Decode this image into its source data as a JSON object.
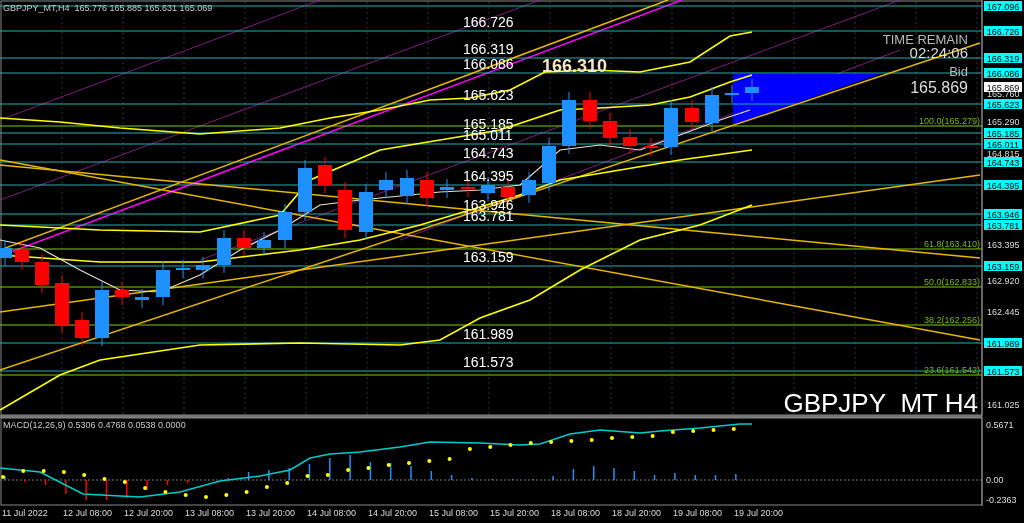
{
  "header": "GBPJPY_MT,H4  165.776 165.885 165.631 165.069",
  "levels": [
    {
      "tag": "167.096"
    },
    {
      "label": "166.726",
      "tag": "166.726"
    },
    {
      "label": "166.319",
      "tag": "166.319"
    },
    {
      "label": "166.086",
      "tag": "166.086"
    },
    {
      "label": "165.623",
      "tag": "165.623"
    },
    {
      "label": "165.185",
      "tag": "165.185"
    },
    {
      "label": "165.011",
      "tag": "165.011"
    },
    {
      "label": "164.743",
      "tag": "164.743"
    },
    {
      "label": "164.395",
      "tag": "164.395"
    },
    {
      "label": "163.946",
      "tag": "163.946"
    },
    {
      "label": "163.781",
      "tag": "163.781"
    },
    {
      "label": "163.159",
      "tag": "163.159"
    },
    {
      "label": "161.989",
      "tag": "161.989"
    },
    {
      "label": "161.573",
      "tag": "161.573"
    }
  ],
  "current_price": "165.869",
  "price_axis": [
    "165.760",
    "165.290",
    "164.815",
    "163.395",
    "162.920",
    "162.445",
    "161.025"
  ],
  "fibonacci": [
    "100.0(165.279)",
    "61.8(163.410)",
    "50.0(162.833)",
    "38.2(162.256)",
    "23.6(161.542)"
  ],
  "high_label": "166.310",
  "timer": {
    "title": "TIME REMAIN",
    "value": "02:24:06",
    "bid_label": "Bid",
    "bid": "165.869"
  },
  "symbol_label": "GBPJPY_MT H4",
  "macd": {
    "label": "MACD(12,26,9) 0.5306 0.4768 0.0538 0.0000",
    "axis": [
      "0.5671",
      "0.00",
      "-0.2363"
    ]
  },
  "time_axis": [
    "11 Jul 2022",
    "12 Jul 08:00",
    "12 Jul 20:00",
    "13 Jul 08:00",
    "13 Jul 20:00",
    "14 Jul 08:00",
    "14 Jul 20:00",
    "15 Jul 08:00",
    "15 Jul 20:00",
    "18 Jul 08:00",
    "18 Jul 20:00",
    "19 Jul 08:00",
    "19 Jul 20:00"
  ]
}
